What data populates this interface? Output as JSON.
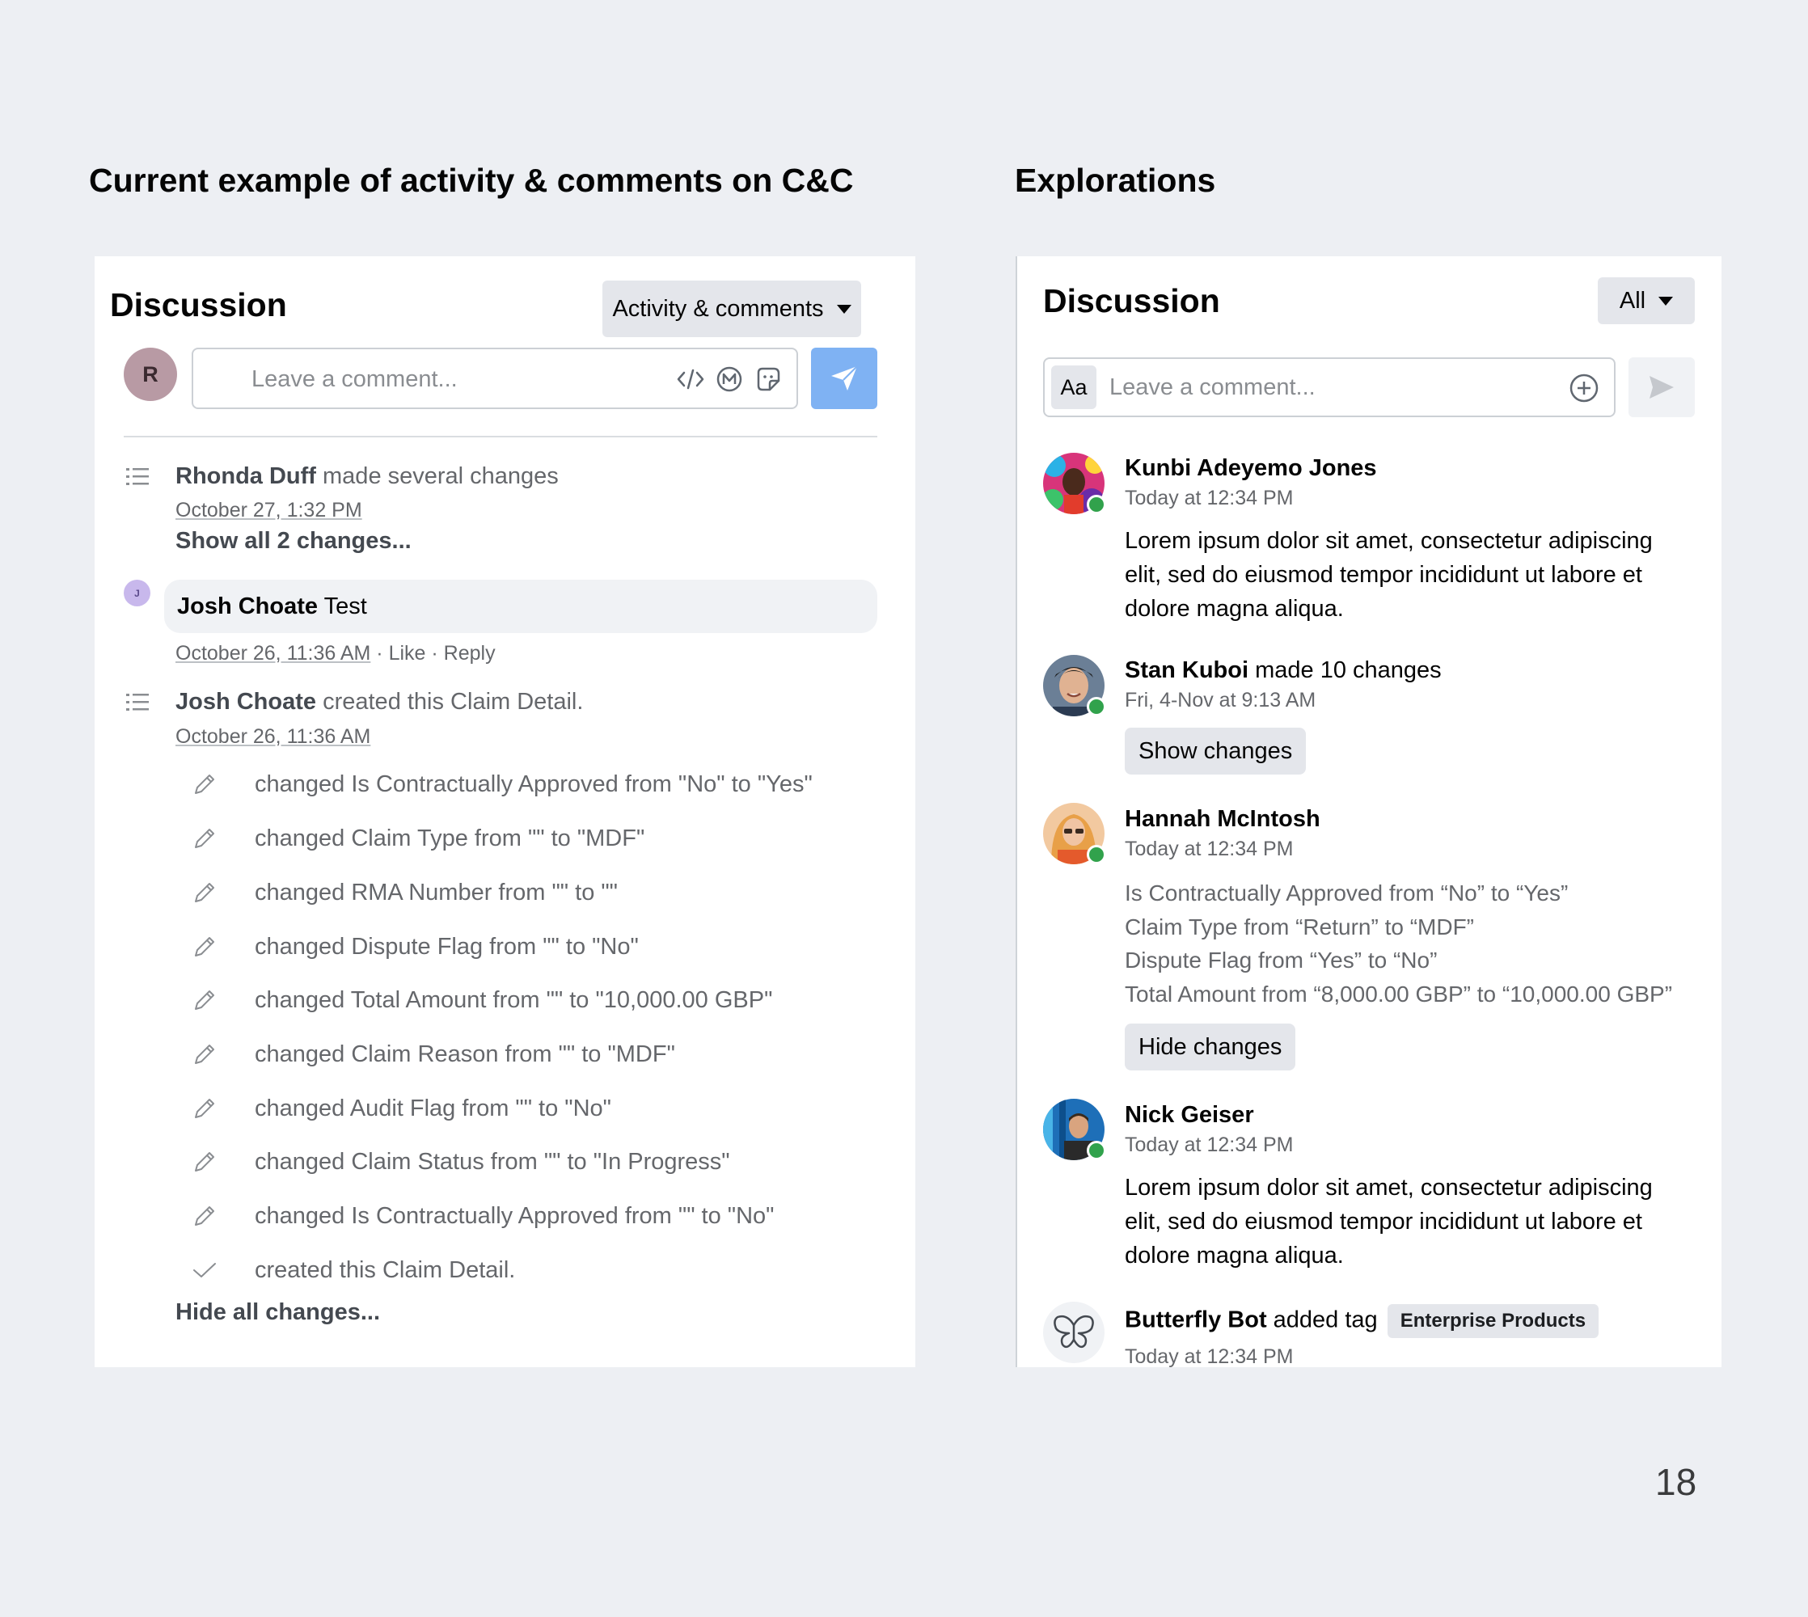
{
  "headings": {
    "left": "Current example of activity & comments on C&C",
    "right": "Explorations"
  },
  "left_panel": {
    "title": "Discussion",
    "filter_label": "Activity & comments",
    "user_initial": "R",
    "comment_placeholder": "Leave a comment...",
    "activity1": {
      "user": "Rhonda Duff",
      "action": " made several changes",
      "date": "October 27, 1:32 PM",
      "show_all": "Show all 2 changes..."
    },
    "comment": {
      "initial": "J",
      "user": "Josh Choate",
      "text": " Test",
      "date": "October 26, 11:36 AM",
      "sep1": " · ",
      "like": "Like",
      "sep2": " · ",
      "reply": "Reply"
    },
    "activity2": {
      "user": "Josh Choate",
      "action": " created this Claim Detail.",
      "date": "October 26, 11:36 AM"
    },
    "changes": [
      "changed Is Contractually Approved from \"No\" to \"Yes\"",
      "changed Claim Type from \"\" to \"MDF\"",
      "changed RMA Number from \"\" to \"\"",
      "changed Dispute Flag from \"\" to \"No\"",
      "changed Total Amount from \"\" to \"10,000.00 GBP\"",
      "changed Claim Reason from \"\" to \"MDF\"",
      "changed Audit Flag from \"\" to \"No\"",
      "changed Claim Status from \"\" to \"In Progress\"",
      "changed Is Contractually Approved from \"\" to \"No\"",
      "created this Claim Detail."
    ],
    "change_icons": [
      "pencil-icon",
      "pencil-icon",
      "pencil-icon",
      "pencil-icon",
      "pencil-icon",
      "pencil-icon",
      "pencil-icon",
      "pencil-icon",
      "pencil-icon",
      "checkmark-icon"
    ],
    "hide_all": "Hide all changes..."
  },
  "right_panel": {
    "title": "Discussion",
    "filter_label": "All",
    "aa_label": "Aa",
    "comment_placeholder": "Leave a comment...",
    "posts": [
      {
        "name": "Kunbi Adeyemo Jones",
        "time": "Today at 12:34 PM",
        "body": "Lorem ipsum dolor sit amet, consectetur adipiscing elit, sed do eiusmod tempor incididunt ut labore et dolore magna aliqua."
      },
      {
        "name": "Stan Kuboi",
        "action": " made 10 changes",
        "time": "Fri, 4-Nov at 9:13 AM",
        "button": "Show changes"
      },
      {
        "name": "Hannah McIntosh",
        "time": "Today at 12:34 PM",
        "changes": [
          "Is Contractually Approved from “No” to “Yes”",
          "Claim Type from “Return” to “MDF”",
          "Dispute Flag from “Yes” to “No”",
          "Total Amount from “8,000.00 GBP” to “10,000.00 GBP”"
        ],
        "button": "Hide changes"
      },
      {
        "name": "Nick Geiser",
        "time": "Today at 12:34 PM",
        "body": "Lorem ipsum dolor sit amet, consectetur adipiscing elit, sed do eiusmod tempor incididunt ut labore et dolore magna aliqua."
      },
      {
        "name": "Butterfly Bot",
        "action": " added tag",
        "tag": "Enterprise Products",
        "time": "Today at 12:34 PM"
      }
    ]
  },
  "colors": {
    "send_button_blue": "#7fb2f3",
    "online_green": "#31a24c",
    "background": "#edeff3"
  },
  "page_number": "18"
}
